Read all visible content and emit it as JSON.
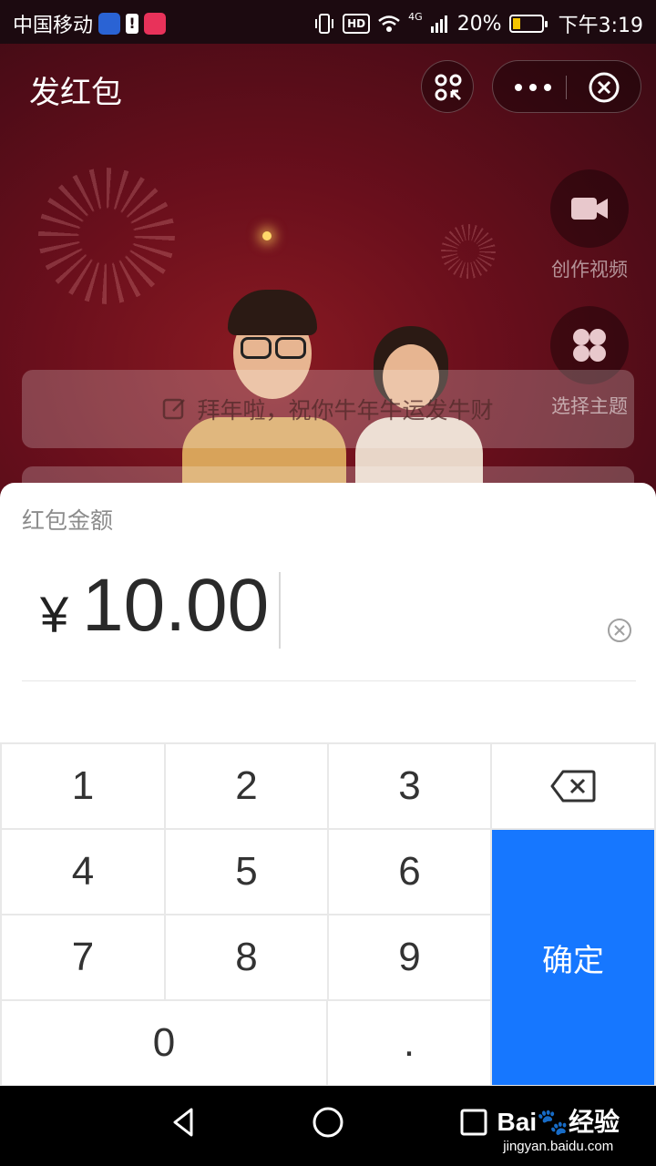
{
  "status_bar": {
    "carrier": "中国移动",
    "network": "4G",
    "battery_percent": "20%",
    "time": "下午3:19",
    "hd": "HD"
  },
  "header": {
    "title": "发红包"
  },
  "side_actions": [
    {
      "label": "创作视频",
      "icon": "video-camera-icon"
    },
    {
      "label": "选择主题",
      "icon": "theme-grid-icon"
    }
  ],
  "greeting": {
    "text": "拜年啦，祝你牛年牛运发牛财",
    "icon": "edit-icon"
  },
  "amount": {
    "label": "红包金额",
    "currency": "¥",
    "value": "10.00"
  },
  "keypad": {
    "keys": [
      "1",
      "2",
      "3",
      "4",
      "5",
      "6",
      "7",
      "8",
      "9",
      "0",
      "."
    ],
    "confirm_label": "确定",
    "confirm_color": "#1677ff"
  },
  "watermark": {
    "brand": "Bai",
    "brand_suffix": "经验",
    "url": "jingyan.baidu.com"
  },
  "colors": {
    "background": "#6a0f1c",
    "accent": "#1677ff"
  }
}
